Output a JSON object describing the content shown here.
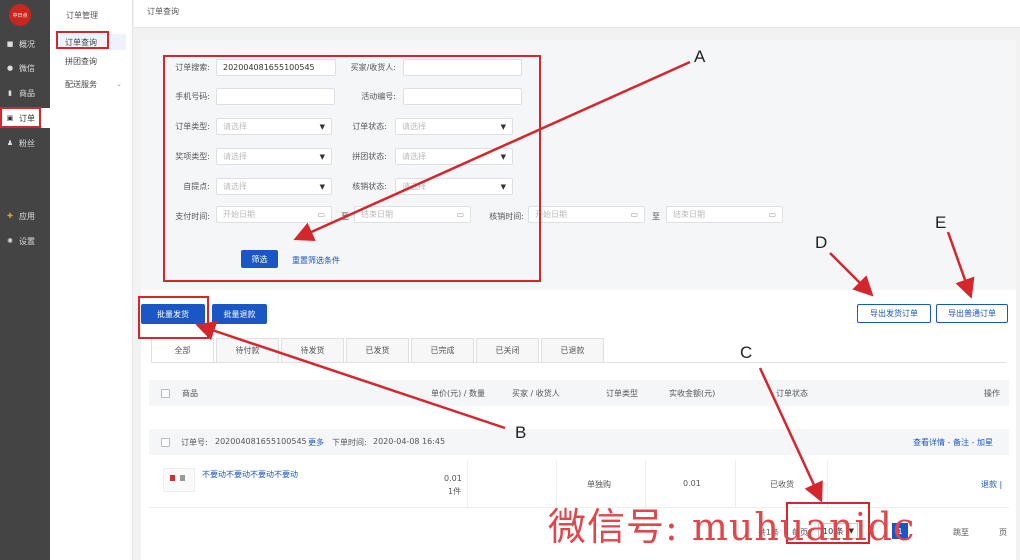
{
  "app": {
    "logo_text": "中日点"
  },
  "nav": {
    "items": [
      {
        "label": "概况",
        "icon": "dashboard-icon"
      },
      {
        "label": "微信",
        "icon": "wechat-icon"
      },
      {
        "label": "商品",
        "icon": "bag-icon"
      },
      {
        "label": "订单",
        "icon": "order-icon",
        "active": true
      },
      {
        "label": "粉丝",
        "icon": "user-icon"
      },
      {
        "label": "应用",
        "icon": "apps-icon"
      },
      {
        "label": "设置",
        "icon": "gear-icon"
      }
    ]
  },
  "subnav": {
    "title": "订单管理",
    "items": [
      {
        "label": "订单查询",
        "active": true
      },
      {
        "label": "拼团查询"
      },
      {
        "label": "配送服务",
        "has_children": true
      }
    ]
  },
  "header": {
    "title": "订单查询"
  },
  "filters": {
    "order_search_label": "订单搜索:",
    "order_search_value": "202004081655100545",
    "buyer_label": "买家/收货人:",
    "buyer_value": "",
    "phone_label": "手机号码:",
    "phone_value": "",
    "activity_label": "活动编号:",
    "activity_value": "",
    "order_type_label": "订单类型:",
    "order_status_label": "订单状态:",
    "prize_type_label": "奖项类型:",
    "group_status_label": "拼团状态:",
    "pickup_label": "自提点:",
    "verify_status_label": "核销状态:",
    "pay_time_label": "支付时间:",
    "verify_time_label": "核销时间:",
    "select_placeholder": "请选择",
    "start_date_placeholder": "开始日期",
    "end_date_placeholder": "结束日期",
    "range_sep": "至",
    "filter_button": "筛选",
    "reset_link": "重置筛选条件"
  },
  "actions": {
    "batch_ship": "批量发货",
    "batch_refund": "批量退款",
    "export_ship": "导出发货订单",
    "export_normal": "导出普通订单"
  },
  "tabs": [
    "全部",
    "待付款",
    "待发货",
    "已发货",
    "已完成",
    "已关闭",
    "已退款"
  ],
  "table": {
    "columns": {
      "product": "商品",
      "price_qty": "单价(元) / 数量",
      "buyer": "买家 / 收货人",
      "order_type": "订单类型",
      "paid": "实收金额(元)",
      "status": "订单状态",
      "ops": "操作"
    },
    "order": {
      "no_label": "订单号:",
      "no": "202004081655100545",
      "more": "更多",
      "time_label": "下单时间:",
      "time": "2020-04-08 16:45",
      "links": "查看详情 - 备注 - 加星",
      "product_name": "不要动不要动不要动不要动",
      "price": "0.01",
      "qty": "1件",
      "order_type": "单独购",
      "paid": "0.01",
      "status": "已收货",
      "op": "退款 |"
    }
  },
  "pager": {
    "total": "共1条",
    "per_page": "每页",
    "page_size": "10 条",
    "current": "1",
    "jump": "跳至",
    "page": "页"
  },
  "annotations": {
    "a": "A",
    "b": "B",
    "c": "C",
    "d": "D",
    "e": "E"
  },
  "watermark": "微信号: muhuanidc",
  "colors": {
    "accent": "#1a56c4",
    "highlight": "#d6262d",
    "nav_bg": "#444444"
  }
}
